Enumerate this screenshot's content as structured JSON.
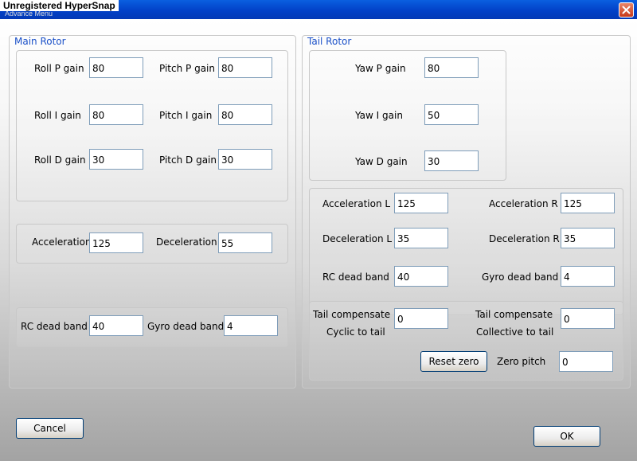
{
  "window": {
    "watermark": "Unregistered HyperSnap",
    "title": "Advance Menu"
  },
  "main_rotor": {
    "title": "Main Rotor",
    "roll_p_label": "Roll P gain",
    "roll_p": "80",
    "roll_i_label": "Roll I gain",
    "roll_i": "80",
    "roll_d_label": "Roll D gain",
    "roll_d": "30",
    "pitch_p_label": "Pitch P gain",
    "pitch_p": "80",
    "pitch_i_label": "Pitch I gain",
    "pitch_i": "80",
    "pitch_d_label": "Pitch D gain",
    "pitch_d": "30",
    "acceleration_label": "Acceleration",
    "acceleration": "125",
    "deceleration_label": "Deceleration",
    "deceleration": "55",
    "rc_dead_band_label": "RC dead band",
    "rc_dead_band": "40",
    "gyro_dead_band_label": "Gyro dead band",
    "gyro_dead_band": "4"
  },
  "tail_rotor": {
    "title": "Tail Rotor",
    "yaw_p_label": "Yaw P gain",
    "yaw_p": "80",
    "yaw_i_label": "Yaw I gain",
    "yaw_i": "50",
    "yaw_d_label": "Yaw D gain",
    "yaw_d": "30",
    "accel_l_label": "Acceleration L",
    "accel_l": "125",
    "accel_r_label": "Acceleration R",
    "accel_r": "125",
    "decel_l_label": "Deceleration L",
    "decel_l": "35",
    "decel_r_label": "Deceleration R",
    "decel_r": "35",
    "rc_dead_band_label": "RC dead band",
    "rc_dead_band": "40",
    "gyro_dead_band_label": "Gyro dead band",
    "gyro_dead_band": "4",
    "tail_comp_cyclic_label_1": "Tail compensate",
    "tail_comp_cyclic_label_2": "Cyclic to tail",
    "tail_comp_cyclic": "0",
    "tail_comp_collective_label_1": "Tail compensate",
    "tail_comp_collective_label_2": "Collective to tail",
    "tail_comp_collective": "0",
    "reset_zero_label": "Reset zero",
    "zero_pitch_label": "Zero pitch",
    "zero_pitch": "0"
  },
  "buttons": {
    "cancel": "Cancel",
    "ok": "OK"
  },
  "icons": {
    "close": "close-icon"
  }
}
